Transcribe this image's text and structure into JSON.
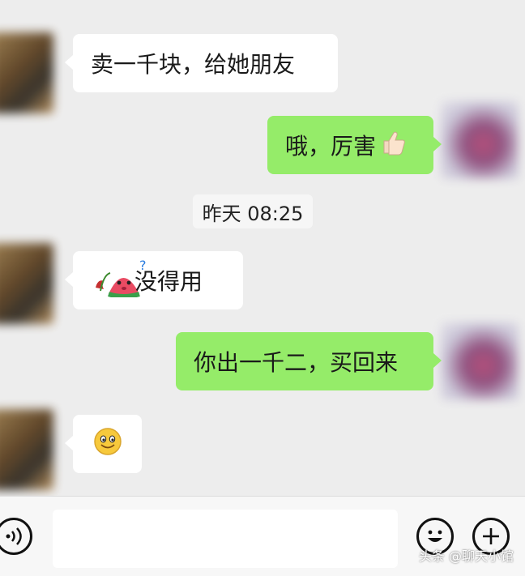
{
  "messages": [
    {
      "side": "in",
      "text": "卖一千块，给她朋友"
    },
    {
      "side": "out",
      "text": "哦，厉害",
      "emoji": "thumbs-up"
    },
    {
      "side": "in",
      "text": "没得用",
      "sticker": "watermelon-wilted-flower"
    },
    {
      "side": "out",
      "text": "你出一千二，买回来"
    },
    {
      "side": "in",
      "text": "",
      "emoji": "smiley"
    }
  ],
  "timestamp": "昨天 08:25",
  "composer": {
    "input_value": "",
    "voice_icon": "voice-icon",
    "emoji_icon": "smiley-face-icon",
    "add_icon": "plus-icon"
  },
  "watermark": "头条 @聊天小馆",
  "colors": {
    "background": "#ededed",
    "incoming_bubble": "#ffffff",
    "outgoing_bubble": "#95ec69"
  }
}
